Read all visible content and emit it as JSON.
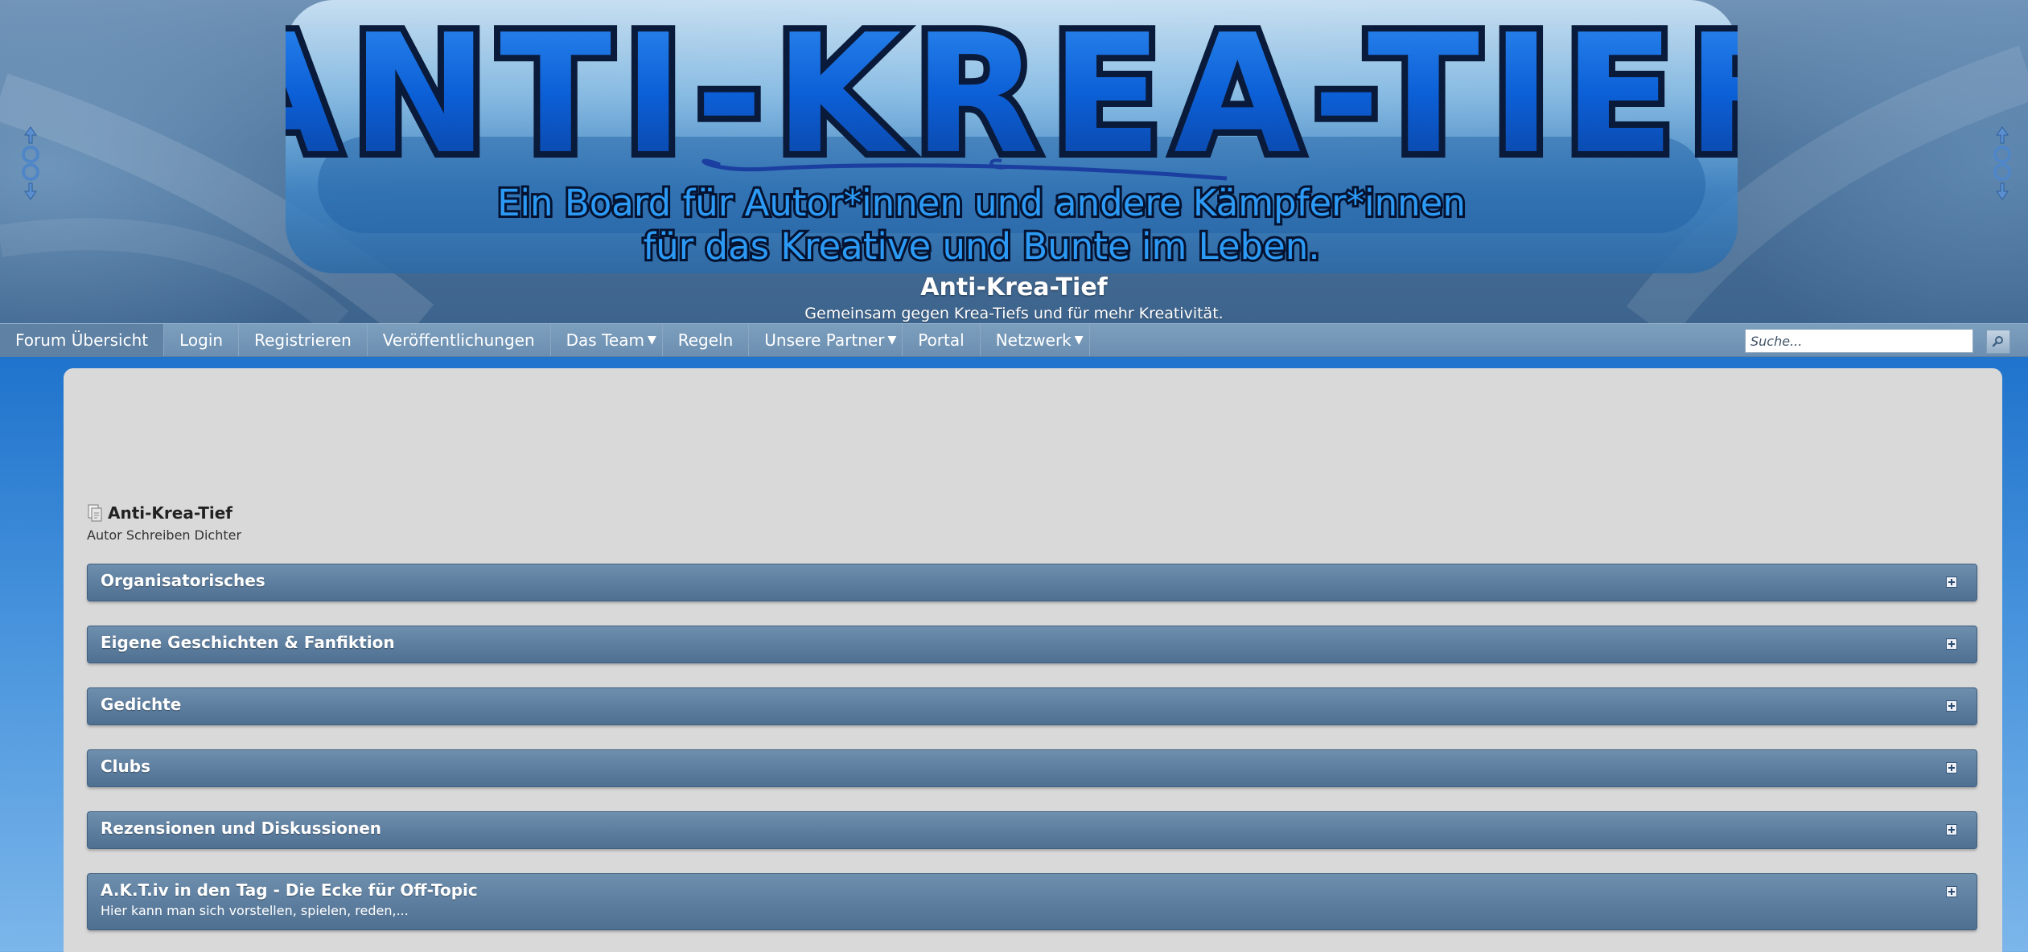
{
  "header": {
    "banner_title": "ANTI-KREA-TIEF",
    "banner_line1": "Ein Board für Autor*innen und andere Kämpfer*innen",
    "banner_line2": "für das Kreative und Bunte im Leben.",
    "site_title": "Anti-Krea-Tief",
    "site_description": "Gemeinsam gegen Krea-Tiefs und für mehr Kreativität."
  },
  "nav": {
    "items": [
      {
        "label": "Forum Übersicht"
      },
      {
        "label": "Login"
      },
      {
        "label": "Registrieren"
      },
      {
        "label": "Veröffentlichungen"
      },
      {
        "label": "Das Team",
        "dropdown": true
      },
      {
        "label": "Regeln"
      },
      {
        "label": "Unsere Partner",
        "dropdown": true
      },
      {
        "label": "Portal"
      },
      {
        "label": "Netzwerk",
        "dropdown": true
      }
    ],
    "search_placeholder": "Suche..."
  },
  "board": {
    "title": "Anti-Krea-Tief",
    "description": "Autor Schreiben Dichter"
  },
  "categories": [
    {
      "title": "Organisatorisches"
    },
    {
      "title": "Eigene Geschichten & Fanfiktion"
    },
    {
      "title": "Gedichte"
    },
    {
      "title": "Clubs"
    },
    {
      "title": "Rezensionen und Diskussionen"
    },
    {
      "title": "A.K.T.iv in den Tag - Die Ecke für Off-Topic",
      "subtitle": "Hier kann man sich vorstellen, spielen, reden,..."
    }
  ],
  "colors": {
    "accent": "#1f70c9",
    "nav": "#6c8fb1",
    "category": "#5c7d9e",
    "panel": "#d9d9d9"
  }
}
